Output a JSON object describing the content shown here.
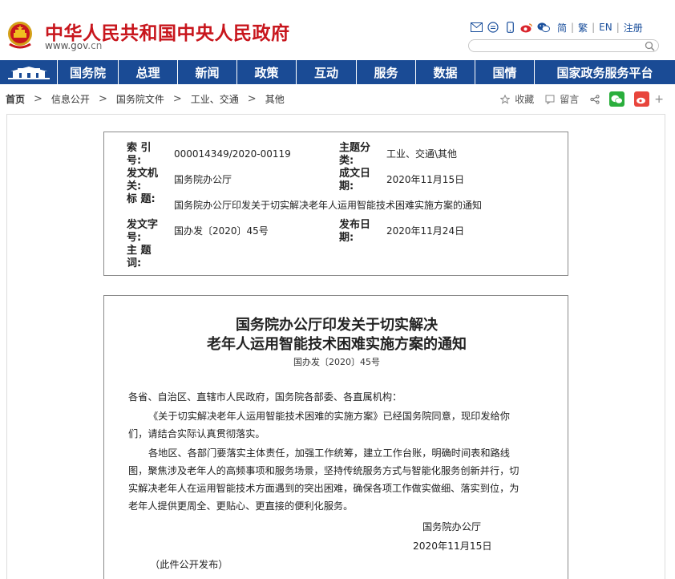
{
  "site": {
    "name": "中华人民共和国中央人民政府",
    "url_main": "www.gov",
    "url_suffix": ".cn"
  },
  "top_links": {
    "simplified": "简",
    "traditional": "繁",
    "english": "EN",
    "register": "注册"
  },
  "search": {
    "placeholder": ""
  },
  "nav": [
    "国务院",
    "总理",
    "新闻",
    "政策",
    "互动",
    "服务",
    "数据",
    "国情",
    "国家政务服务平台"
  ],
  "breadcrumb": [
    "首页",
    "信息公开",
    "国务院文件",
    "工业、交通",
    "其他"
  ],
  "share": {
    "favorite": "收藏",
    "comment": "留言"
  },
  "info": {
    "index_label": "索 引 号:",
    "index_value": "000014349/2020-00119",
    "category_label": "主题分类:",
    "category_value": "工业、交通\\其他",
    "issuer_label": "发文机关:",
    "issuer_value": "国务院办公厅",
    "created_label": "成文日期:",
    "created_value": "2020年11月15日",
    "title_label": "标  题:",
    "title_value": "国务院办公厅印发关于切实解决老年人运用智能技术困难实施方案的通知",
    "docno_label": "发文字号:",
    "docno_value": "国办发〔2020〕45号",
    "published_label": "发布日期:",
    "published_value": "2020年11月24日",
    "subject_label": "主 题 词:",
    "subject_value": ""
  },
  "document": {
    "title_line1": "国务院办公厅印发关于切实解决",
    "title_line2": "老年人运用智能技术困难实施方案的通知",
    "doc_number": "国办发〔2020〕45号",
    "salutation": "各省、自治区、直辖市人民政府，国务院各部委、各直属机构：",
    "p1_line1": "《关于切实解决老年人运用智能技术困难的实施方案》已经国务院同意，现印发给你",
    "p1_line2": "们，请结合实际认真贯彻落实。",
    "p2_line1": "各地区、各部门要落实主体责任，加强工作统筹，建立工作台账，明确时间表和路线",
    "p2_line2": "图，聚焦涉及老年人的高频事项和服务场景，坚持传统服务方式与智能化服务创新并行，切",
    "p2_line3": "实解决老年人在运用智能技术方面遇到的突出困难，确保各项工作做实做细、落实到位，为",
    "p2_line4": "老年人提供更周全、更贴心、更直接的便利化服务。",
    "signature": "国务院办公厅",
    "date": "2020年11月15日",
    "note": "（此件公开发布）"
  },
  "colors": {
    "brand_red": "#c8161d",
    "nav_blue": "#1a4b95"
  }
}
